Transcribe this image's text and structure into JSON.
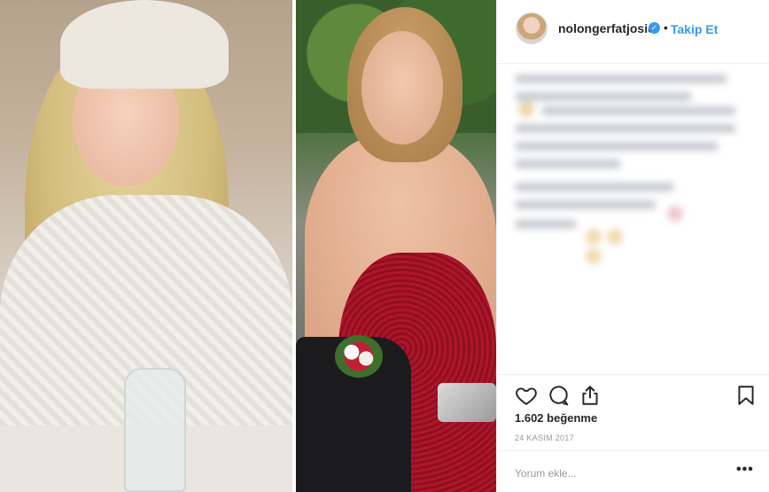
{
  "header": {
    "username": "nolongerfatjosie",
    "separator": "•",
    "follow_label": "Takip Et",
    "verified_icon": "verified-badge-icon"
  },
  "media": {
    "left_photo": "before photo",
    "right_photo": "after photo"
  },
  "actions": {
    "icons": [
      "heart-icon",
      "comment-icon",
      "share-icon",
      "bookmark-icon"
    ]
  },
  "stats": {
    "likes": "1.602 beğenme",
    "date": "24 KASIM 2017"
  },
  "comment": {
    "placeholder": "Yorum ekle...",
    "more_label": "•••"
  },
  "colors": {
    "link": "#3897f0",
    "text": "#262626",
    "muted": "#999999",
    "border": "#efefef"
  }
}
